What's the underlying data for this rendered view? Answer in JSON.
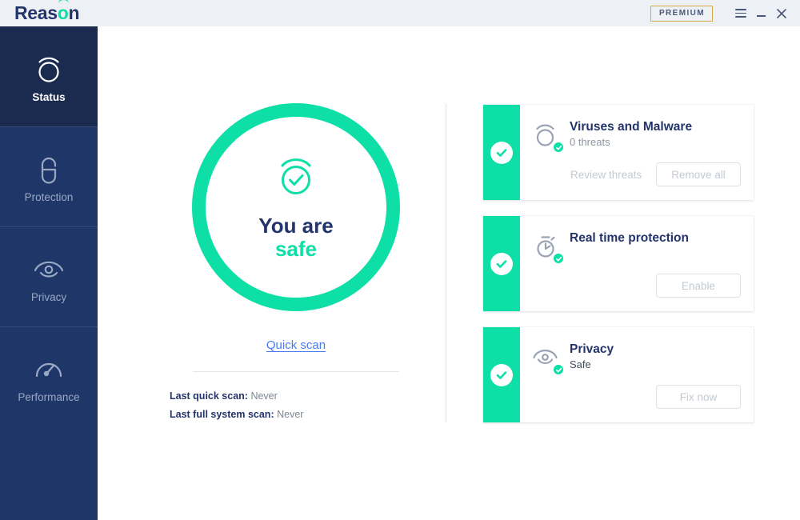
{
  "titlebar": {
    "logo_text_a": "Reas",
    "logo_text_o": "o",
    "logo_text_b": "n",
    "premium_label": "PREMIUM",
    "menu_icon": "hamburger-menu-icon",
    "minimize_icon": "minimize-icon",
    "close_icon": "close-icon",
    "bg_color": "#edf1f6",
    "premium_border_color": "#d6a84a"
  },
  "sidebar": {
    "bg_color": "#1f3668",
    "active_bg_color": "#1b2b50",
    "items": [
      {
        "label": "Status",
        "icon": "shield-scan-icon",
        "active": true
      },
      {
        "label": "Protection",
        "icon": "lock-icon",
        "active": false
      },
      {
        "label": "Privacy",
        "icon": "eye-icon",
        "active": false
      },
      {
        "label": "Performance",
        "icon": "gauge-icon",
        "active": false
      }
    ]
  },
  "status": {
    "ring_color": "#0ddfa6",
    "icon": "shield-check-icon",
    "headline_line1": "You are",
    "headline_line2": "safe",
    "quick_scan_link": "Quick scan",
    "quick_scan_link_color": "#4a7bf0",
    "last_quick_scan_label": "Last quick scan:",
    "last_quick_scan_value": "Never",
    "last_full_scan_label": "Last full system scan:",
    "last_full_scan_value": "Never"
  },
  "cards": [
    {
      "status_icon": "check-circle-icon",
      "icon": "shield-scan-icon",
      "badge_icon": "check-badge-icon",
      "title": "Viruses and Malware",
      "subtitle": "0 threats",
      "subtitle_muted": true,
      "link_label": "Review threats",
      "button_label": "Remove all",
      "stripe_color": "#0ddfa6"
    },
    {
      "status_icon": "check-circle-icon",
      "icon": "stopwatch-icon",
      "badge_icon": "check-badge-icon",
      "title": "Real time protection",
      "subtitle": "",
      "subtitle_muted": true,
      "link_label": "",
      "button_label": "Enable",
      "stripe_color": "#0ddfa6"
    },
    {
      "status_icon": "check-circle-icon",
      "icon": "eye-icon",
      "badge_icon": "check-badge-icon",
      "title": "Privacy",
      "subtitle": "Safe",
      "subtitle_muted": false,
      "link_label": "",
      "button_label": "Fix now",
      "stripe_color": "#0ddfa6"
    }
  ]
}
